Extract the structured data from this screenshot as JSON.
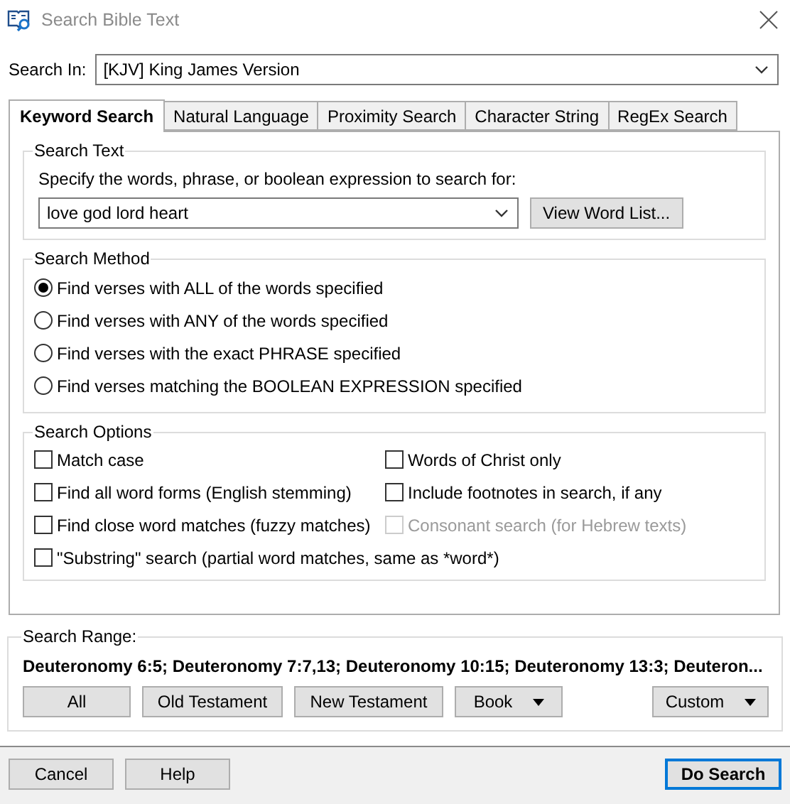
{
  "window": {
    "title": "Search Bible Text"
  },
  "search_in": {
    "label": "Search In:",
    "value": "[KJV] King James Version"
  },
  "tabs": [
    {
      "label": "Keyword Search",
      "selected": true
    },
    {
      "label": "Natural Language",
      "selected": false
    },
    {
      "label": "Proximity Search",
      "selected": false
    },
    {
      "label": "Character String",
      "selected": false
    },
    {
      "label": "RegEx Search",
      "selected": false
    }
  ],
  "search_text": {
    "legend": "Search Text",
    "prompt": "Specify the words, phrase, or boolean expression to search for:",
    "value": "love god lord heart",
    "button": "View Word List..."
  },
  "search_method": {
    "legend": "Search Method",
    "options": [
      {
        "label": "Find verses with ALL of the words specified",
        "selected": true
      },
      {
        "label": "Find verses with ANY of the words specified",
        "selected": false
      },
      {
        "label": "Find verses with the exact PHRASE specified",
        "selected": false
      },
      {
        "label": "Find verses matching the BOOLEAN EXPRESSION specified",
        "selected": false
      }
    ]
  },
  "search_options": {
    "legend": "Search Options",
    "options": [
      {
        "label": "Match case",
        "checked": false,
        "disabled": false
      },
      {
        "label": "Words of Christ only",
        "checked": false,
        "disabled": false
      },
      {
        "label": "Find all word forms (English stemming)",
        "checked": false,
        "disabled": false
      },
      {
        "label": "Include footnotes in search, if any",
        "checked": false,
        "disabled": false
      },
      {
        "label": "Find close word matches (fuzzy matches)",
        "checked": false,
        "disabled": false
      },
      {
        "label": "Consonant search (for Hebrew texts)",
        "checked": false,
        "disabled": true
      },
      {
        "label": "\"Substring\" search (partial word matches, same as *word*)",
        "checked": false,
        "disabled": false
      }
    ]
  },
  "search_range": {
    "legend": "Search Range:",
    "value": "Deuteronomy 6:5; Deuteronomy 7:7,13; Deuteronomy 10:15; Deuteronomy 13:3; Deuteron...",
    "buttons": [
      {
        "label": "All",
        "kind": "button"
      },
      {
        "label": "Old Testament",
        "kind": "button"
      },
      {
        "label": "New Testament",
        "kind": "button"
      },
      {
        "label": "Book",
        "kind": "dropdown"
      },
      {
        "label": "Custom",
        "kind": "dropdown"
      }
    ]
  },
  "footer_buttons": [
    {
      "label": "Cancel",
      "default": false
    },
    {
      "label": "Help",
      "default": false
    },
    {
      "label": "Do Search",
      "default": true
    }
  ]
}
